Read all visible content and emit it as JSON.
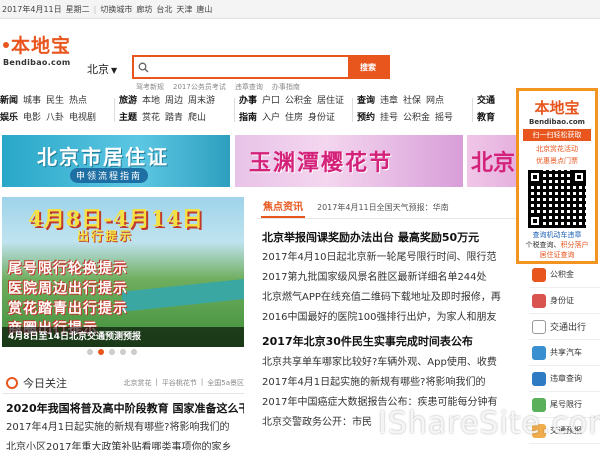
{
  "topbar": {
    "date": "2017年4月11日",
    "weekday": "星期二",
    "switch_label": "切换城市",
    "cities": [
      "廊坊",
      "台北",
      "天津",
      "唐山"
    ]
  },
  "header": {
    "logo_text": "本地宝",
    "logo_domain": "Bendibao.com",
    "city": "北京",
    "search_button": "搜索",
    "search_value": "",
    "hot_links": [
      "驾考新规",
      "2017公务员考试",
      "违章查询",
      "办事指南"
    ]
  },
  "nav": {
    "col1": {
      "row1": [
        "新闻",
        "城事",
        "民生",
        "热点"
      ],
      "row2": [
        "娱乐",
        "电影",
        "八卦",
        "电视剧"
      ]
    },
    "col2": {
      "row1": [
        "旅游",
        "本地",
        "周边",
        "周末游"
      ],
      "row2": [
        "主题",
        "赏花",
        "踏青",
        "爬山"
      ]
    },
    "col3": {
      "row1": [
        "办事",
        "户口",
        "公积金",
        "居住证"
      ],
      "row2": [
        "指南",
        "入户",
        "住房",
        "身份证"
      ]
    },
    "col4": {
      "row1": [
        "查询",
        "违章",
        "社保",
        "网点"
      ],
      "row2": [
        "预约",
        "挂号",
        "公积金",
        "摇号"
      ]
    },
    "col5": {
      "row1": [
        "交通"
      ],
      "row2": [
        "教育"
      ]
    }
  },
  "banners": {
    "b1_title": "北京市居住证",
    "b1_sub": "申领流程指南",
    "b2_title": "玉渊潭樱花节",
    "b3_title": "北京"
  },
  "hero": {
    "date_text": "4月8日-4月14日",
    "sub_text": "出行提示",
    "lines": [
      "尾号限行轮换提示",
      "医院周边出行提示",
      "赏花踏青出行提示",
      "商圈出行提示"
    ],
    "caption": "4月8日至14日北京交通预测预报",
    "slide_count": 5,
    "active_slide": 1
  },
  "news": {
    "section_title": "焦点资讯",
    "weather": "2017年4月11日全国天气预报：华南",
    "headline1": "北京举报闯课奖励办法出台 最高奖励50万元",
    "lines1": [
      "2017年4月10日起北京新一轮尾号限行时间、限行范",
      "2017第九批国家级风景名胜区最新详细名单244处",
      "北京燃气APP在线充值二维码下载地址及即时报修，再",
      "2016中国最好的医院100强排行出炉，为家人和朋友"
    ],
    "headline2": "2017年北京30件民生实事完成时间表公布",
    "lines2": [
      "北京共享单车哪家比较好?车辆外观、App使用、收费",
      "2017年4月1日起实施的新规有哪些?将影响我们的",
      "2017年中国癌症大数据报告公布：疾患可能每分钟有",
      "北京交警政务公开：市民"
    ]
  },
  "today": {
    "title": "今日关注",
    "tags": [
      "北京赏花",
      "平谷桃花节",
      "全国5a景区"
    ],
    "headline": "2020年我国将普及高中阶段教育 国家准备这么干",
    "line1": "2017年4月1日起实施的新规有哪些?将影响我们的",
    "line2": "北京小区2017年重大政策补贴看哪类事项你的家乡"
  },
  "services": {
    "items": [
      {
        "label": "公积金",
        "color": "#e8561e"
      },
      {
        "label": "身份证",
        "color": "#d9534f"
      },
      {
        "label": "交通出行",
        "color": ""
      },
      {
        "label": "共享汽车",
        "color": "#3a8fd0"
      },
      {
        "label": "违章查询",
        "color": "#2e7bc4"
      },
      {
        "label": "尾号限行",
        "color": "#5bb15b"
      },
      {
        "label": "交通预报",
        "color": "#f0ad4e"
      }
    ]
  },
  "promo": {
    "logo_text": "本地宝",
    "logo_domain": "Bendibao.com",
    "bar": "扫一扫轻松获取",
    "r1": "北京赏花活动",
    "r2": "优惠景点门票",
    "r3": "查询机动车违章",
    "r4a": "个税查询、",
    "r4b": "积分落户",
    "r5": "居住证查询"
  },
  "watermark": "IShareSite.com"
}
